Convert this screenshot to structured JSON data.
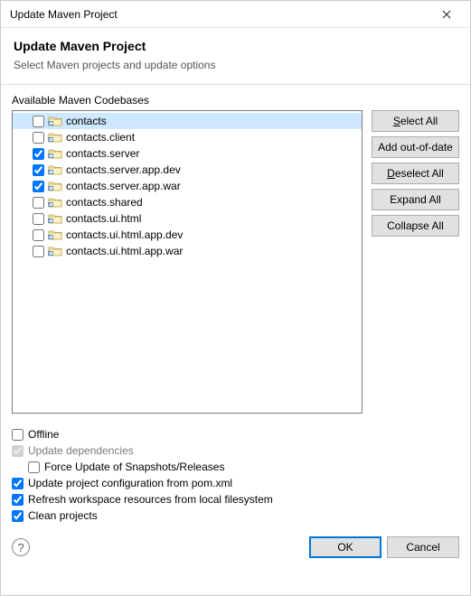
{
  "window": {
    "title": "Update Maven Project"
  },
  "header": {
    "title": "Update Maven Project",
    "subtitle": "Select Maven projects and update options"
  },
  "codebases": {
    "label": "Available Maven Codebases",
    "items": [
      {
        "label": "contacts",
        "checked": false,
        "selected": true
      },
      {
        "label": "contacts.client",
        "checked": false,
        "selected": false
      },
      {
        "label": "contacts.server",
        "checked": true,
        "selected": false
      },
      {
        "label": "contacts.server.app.dev",
        "checked": true,
        "selected": false
      },
      {
        "label": "contacts.server.app.war",
        "checked": true,
        "selected": false
      },
      {
        "label": "contacts.shared",
        "checked": false,
        "selected": false
      },
      {
        "label": "contacts.ui.html",
        "checked": false,
        "selected": false
      },
      {
        "label": "contacts.ui.html.app.dev",
        "checked": false,
        "selected": false
      },
      {
        "label": "contacts.ui.html.app.war",
        "checked": false,
        "selected": false
      }
    ]
  },
  "side": {
    "select_all": "Select All",
    "add_ood": "Add out-of-date",
    "deselect_all": "Deselect All",
    "expand_all": "Expand All",
    "collapse_all": "Collapse All"
  },
  "options": {
    "offline": {
      "label": "Offline",
      "checked": false,
      "disabled": false
    },
    "update_deps": {
      "label": "Update dependencies",
      "checked": true,
      "disabled": true
    },
    "force_update": {
      "label": "Force Update of Snapshots/Releases",
      "checked": false,
      "disabled": false
    },
    "update_config": {
      "label": "Update project configuration from pom.xml",
      "checked": true,
      "disabled": false
    },
    "refresh_ws": {
      "label": "Refresh workspace resources from local filesystem",
      "checked": true,
      "disabled": false
    },
    "clean_proj": {
      "label": "Clean projects",
      "checked": true,
      "disabled": false
    }
  },
  "footer": {
    "ok": "OK",
    "cancel": "Cancel"
  }
}
